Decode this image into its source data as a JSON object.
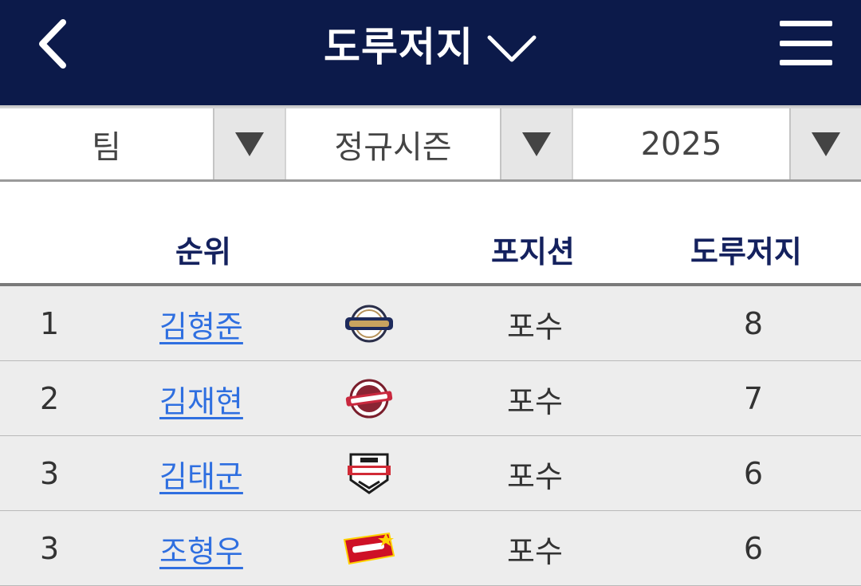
{
  "header": {
    "title": "도루저지",
    "back_icon": "chevron-left-icon",
    "title_dropdown_icon": "chevron-down-icon",
    "menu_icon": "hamburger-menu-icon"
  },
  "filters": [
    {
      "value": "팀",
      "icon": "triangle-down-icon"
    },
    {
      "value": "정규시즌",
      "icon": "triangle-down-icon"
    },
    {
      "value": "2025",
      "icon": "triangle-down-icon"
    }
  ],
  "table": {
    "headers": {
      "rank": "순위",
      "position": "포지션",
      "stat": "도루저지"
    },
    "rows": [
      {
        "rank": "1",
        "name": "김형준",
        "team_logo": "nc-dinos-logo",
        "position": "포수",
        "value": "8"
      },
      {
        "rank": "2",
        "name": "김재현",
        "team_logo": "kiwoom-heroes-logo",
        "position": "포수",
        "value": "7"
      },
      {
        "rank": "3",
        "name": "김태군",
        "team_logo": "kia-tigers-logo",
        "position": "포수",
        "value": "6"
      },
      {
        "rank": "3",
        "name": "조형우",
        "team_logo": "ssg-landers-logo",
        "position": "포수",
        "value": "6"
      }
    ]
  },
  "colors": {
    "header_bg": "#0c1a4a",
    "header_text": "#14215e",
    "link": "#2f6fe0",
    "row_bg": "#ededed"
  }
}
